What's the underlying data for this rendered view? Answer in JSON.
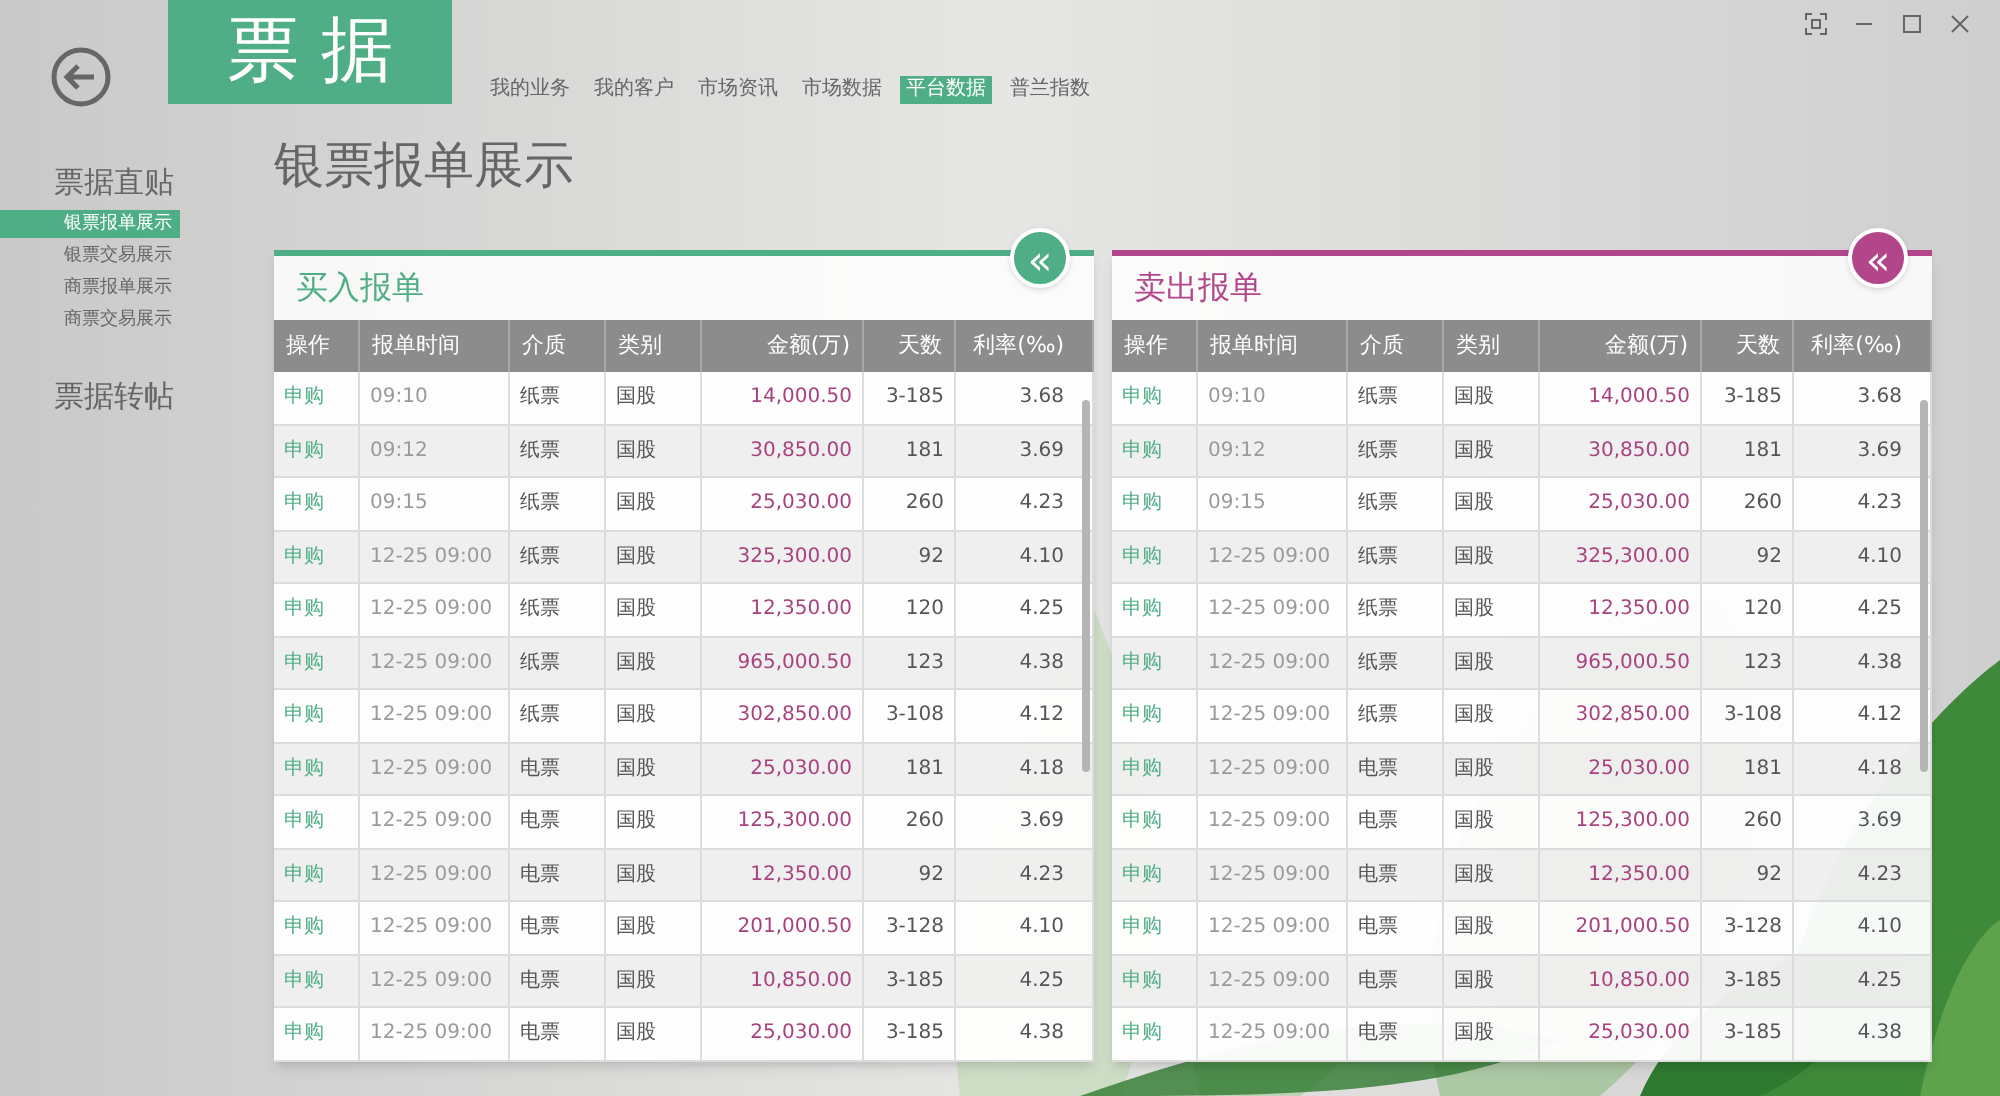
{
  "logo": "票 据",
  "nav": [
    {
      "label": "我的业务",
      "selected": false
    },
    {
      "label": "我的客户",
      "selected": false
    },
    {
      "label": "市场资讯",
      "selected": false
    },
    {
      "label": "市场数据",
      "selected": false
    },
    {
      "label": "平台数据",
      "selected": true
    },
    {
      "label": "普兰指数",
      "selected": false
    }
  ],
  "sidebar": [
    {
      "label": "票据直贴",
      "children": [
        {
          "label": "银票报单展示",
          "selected": true
        },
        {
          "label": "银票交易展示",
          "selected": false
        },
        {
          "label": "商票报单展示",
          "selected": false
        },
        {
          "label": "商票交易展示",
          "selected": false
        }
      ]
    },
    {
      "label": "票据转帖"
    }
  ],
  "page_title": "银票报单展示",
  "panels": [
    {
      "title": "买入报单",
      "color": "#4fae86",
      "collapse_button": "«",
      "columns": [
        "操作",
        "报单时间",
        "介质",
        "类别",
        "金额(万)",
        "天数",
        "利率(‰)"
      ],
      "rows": [
        [
          "申购",
          "09:10",
          "纸票",
          "国股",
          "14,000.50",
          "3-185",
          "3.68"
        ],
        [
          "申购",
          "09:12",
          "纸票",
          "国股",
          "30,850.00",
          "181",
          "3.69"
        ],
        [
          "申购",
          "09:15",
          "纸票",
          "国股",
          "25,030.00",
          "260",
          "4.23"
        ],
        [
          "申购",
          "12-25 09:00",
          "纸票",
          "国股",
          "325,300.00",
          "92",
          "4.10"
        ],
        [
          "申购",
          "12-25 09:00",
          "纸票",
          "国股",
          "12,350.00",
          "120",
          "4.25"
        ],
        [
          "申购",
          "12-25 09:00",
          "纸票",
          "国股",
          "965,000.50",
          "123",
          "4.38"
        ],
        [
          "申购",
          "12-25 09:00",
          "纸票",
          "国股",
          "302,850.00",
          "3-108",
          "4.12"
        ],
        [
          "申购",
          "12-25 09:00",
          "电票",
          "国股",
          "25,030.00",
          "181",
          "4.18"
        ],
        [
          "申购",
          "12-25 09:00",
          "电票",
          "国股",
          "125,300.00",
          "260",
          "3.69"
        ],
        [
          "申购",
          "12-25 09:00",
          "电票",
          "国股",
          "12,350.00",
          "92",
          "4.23"
        ],
        [
          "申购",
          "12-25 09:00",
          "电票",
          "国股",
          "201,000.50",
          "3-128",
          "4.10"
        ],
        [
          "申购",
          "12-25 09:00",
          "电票",
          "国股",
          "10,850.00",
          "3-185",
          "4.25"
        ],
        [
          "申购",
          "12-25 09:00",
          "电票",
          "国股",
          "25,030.00",
          "3-185",
          "4.38"
        ]
      ]
    },
    {
      "title": "卖出报单",
      "color": "#b3468a",
      "collapse_button": "«",
      "columns": [
        "操作",
        "报单时间",
        "介质",
        "类别",
        "金额(万)",
        "天数",
        "利率(‰)"
      ],
      "rows": [
        [
          "申购",
          "09:10",
          "纸票",
          "国股",
          "14,000.50",
          "3-185",
          "3.68"
        ],
        [
          "申购",
          "09:12",
          "纸票",
          "国股",
          "30,850.00",
          "181",
          "3.69"
        ],
        [
          "申购",
          "09:15",
          "纸票",
          "国股",
          "25,030.00",
          "260",
          "4.23"
        ],
        [
          "申购",
          "12-25 09:00",
          "纸票",
          "国股",
          "325,300.00",
          "92",
          "4.10"
        ],
        [
          "申购",
          "12-25 09:00",
          "纸票",
          "国股",
          "12,350.00",
          "120",
          "4.25"
        ],
        [
          "申购",
          "12-25 09:00",
          "纸票",
          "国股",
          "965,000.50",
          "123",
          "4.38"
        ],
        [
          "申购",
          "12-25 09:00",
          "纸票",
          "国股",
          "302,850.00",
          "3-108",
          "4.12"
        ],
        [
          "申购",
          "12-25 09:00",
          "电票",
          "国股",
          "25,030.00",
          "181",
          "4.18"
        ],
        [
          "申购",
          "12-25 09:00",
          "电票",
          "国股",
          "125,300.00",
          "260",
          "3.69"
        ],
        [
          "申购",
          "12-25 09:00",
          "电票",
          "国股",
          "12,350.00",
          "92",
          "4.23"
        ],
        [
          "申购",
          "12-25 09:00",
          "电票",
          "国股",
          "201,000.50",
          "3-128",
          "4.10"
        ],
        [
          "申购",
          "12-25 09:00",
          "电票",
          "国股",
          "10,850.00",
          "3-185",
          "4.25"
        ],
        [
          "申购",
          "12-25 09:00",
          "电票",
          "国股",
          "25,030.00",
          "3-185",
          "4.38"
        ]
      ]
    }
  ]
}
